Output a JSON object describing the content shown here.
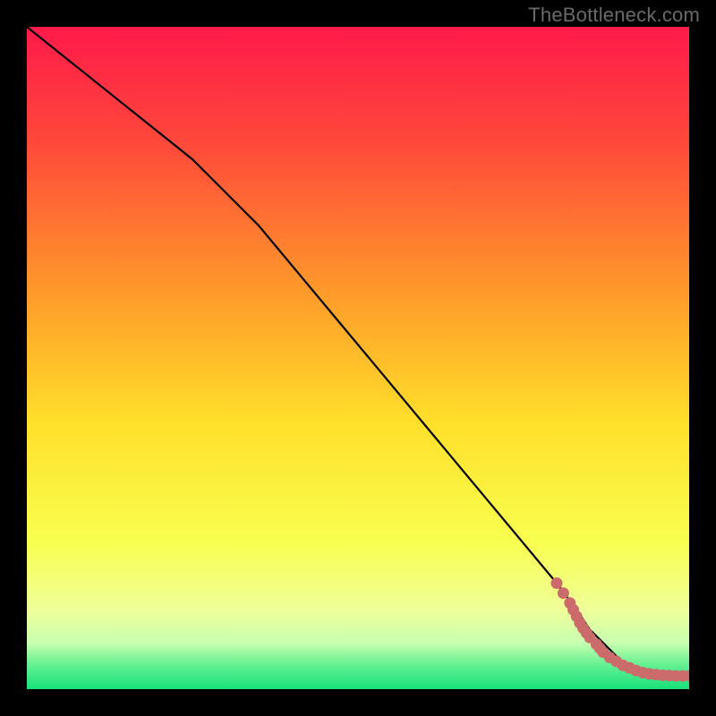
{
  "watermark": "TheBottleneck.com",
  "colors": {
    "bg": "#000000",
    "gradient_top": "#ff1a4a",
    "gradient_mid1": "#ff8a2a",
    "gradient_mid2": "#ffe02a",
    "gradient_mid3": "#f8ff60",
    "gradient_band": "#f0ff9a",
    "gradient_green": "#18e07a",
    "line": "#000000",
    "marker": "#cc6b6b"
  },
  "chart_data": {
    "type": "line",
    "title": "",
    "xlabel": "",
    "ylabel": "",
    "xlim": [
      0,
      100
    ],
    "ylim": [
      0,
      100
    ],
    "series": [
      {
        "name": "curve",
        "x": [
          0,
          5,
          10,
          15,
          20,
          25,
          30,
          35,
          40,
          45,
          50,
          55,
          60,
          65,
          70,
          75,
          80,
          83,
          85,
          87,
          89,
          90,
          92,
          94,
          96,
          98,
          100
        ],
        "y": [
          100,
          96,
          92,
          88,
          84,
          80,
          75,
          70,
          64,
          58,
          52,
          46,
          40,
          34,
          28,
          22,
          16,
          12,
          9,
          7,
          5,
          4,
          3,
          2,
          2,
          2,
          2
        ]
      },
      {
        "name": "markers",
        "type": "scatter",
        "x": [
          80,
          81,
          82,
          82.5,
          83,
          83.5,
          84,
          84.5,
          85,
          86,
          86.5,
          87,
          88,
          89,
          90,
          91,
          92,
          93,
          94,
          95,
          96,
          97,
          98,
          99,
          100
        ],
        "y": [
          16,
          14.5,
          13,
          12,
          11,
          10,
          9.2,
          8.5,
          7.8,
          6.8,
          6.2,
          5.6,
          4.8,
          4.2,
          3.6,
          3.2,
          2.8,
          2.5,
          2.3,
          2.2,
          2.1,
          2.05,
          2.0,
          2.0,
          2.0
        ]
      }
    ],
    "gradient_stops": [
      {
        "offset": 0.0,
        "color": "#ff1a4a"
      },
      {
        "offset": 0.18,
        "color": "#ff4a3a"
      },
      {
        "offset": 0.4,
        "color": "#ff9a2a"
      },
      {
        "offset": 0.6,
        "color": "#ffe02a"
      },
      {
        "offset": 0.78,
        "color": "#f8ff50"
      },
      {
        "offset": 0.88,
        "color": "#f0ff9a"
      },
      {
        "offset": 0.93,
        "color": "#c8ffb0"
      },
      {
        "offset": 0.965,
        "color": "#60f090"
      },
      {
        "offset": 1.0,
        "color": "#18e07a"
      }
    ]
  }
}
